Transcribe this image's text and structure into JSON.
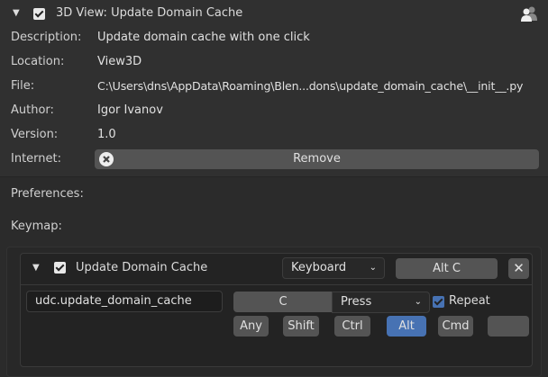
{
  "addon": {
    "title": "3D View: Update Domain Cache",
    "enabled": true,
    "rows": [
      {
        "label": "Description:",
        "value": "Update domain cache with one click"
      },
      {
        "label": "Location:",
        "value": "View3D"
      },
      {
        "label": "File:",
        "value": "C:\\Users\\dns\\AppData\\Roaming\\Blen...dons\\update_domain_cache\\__init__.py"
      },
      {
        "label": "Author:",
        "value": "Igor Ivanov"
      },
      {
        "label": "Version:",
        "value": "1.0"
      }
    ],
    "internet_label": "Internet:",
    "remove_label": "Remove"
  },
  "preferences_label": "Preferences:",
  "keymap_label": "Keymap:",
  "keymap_item": {
    "name": "Update Domain Cache",
    "enabled": true,
    "input_type": "Keyboard",
    "shortcut": "Alt C",
    "operator": "udc.update_domain_cache",
    "key": "C",
    "event": "Press",
    "repeat_label": "Repeat",
    "repeat": true,
    "modifiers": [
      {
        "label": "Any",
        "active": false
      },
      {
        "label": "Shift",
        "active": false
      },
      {
        "label": "Ctrl",
        "active": false
      },
      {
        "label": "Alt",
        "active": true
      },
      {
        "label": "Cmd",
        "active": false
      },
      {
        "label": "",
        "active": false
      }
    ]
  },
  "colors": {
    "accent": "#4772b3"
  }
}
